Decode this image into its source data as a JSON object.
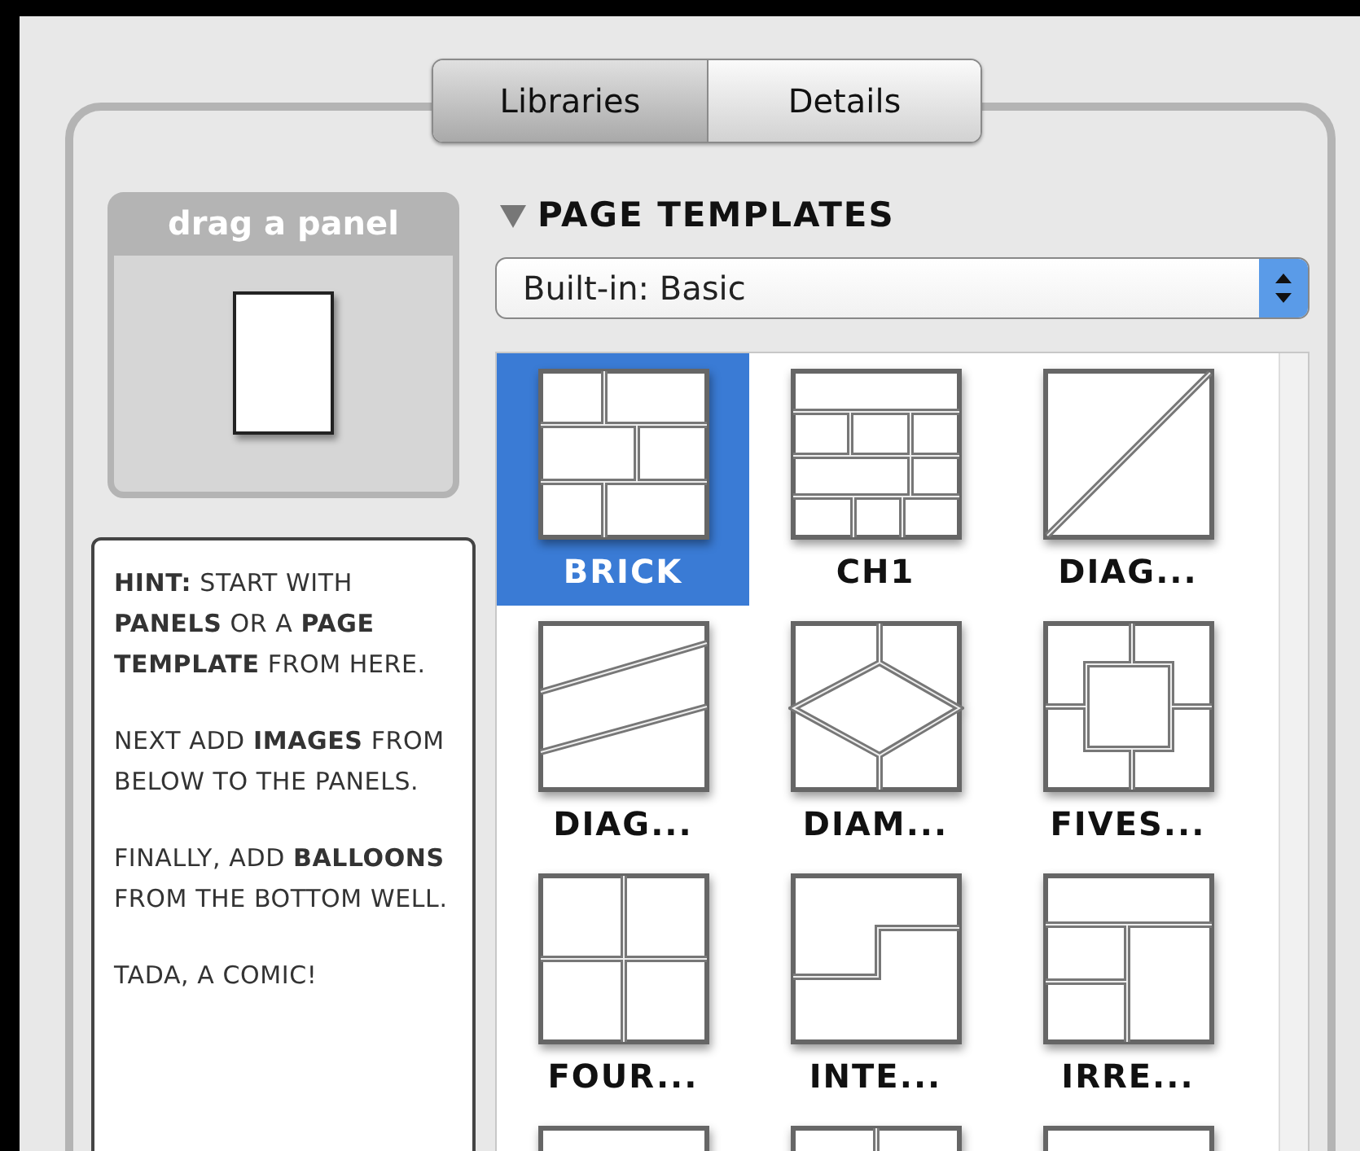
{
  "tabs": [
    {
      "label": "Libraries",
      "selected": true
    },
    {
      "label": "Details",
      "selected": false
    }
  ],
  "panel_well": {
    "title": "drag a panel"
  },
  "hint": [
    "**HINT:** START WITH **PANELS** OR A **PAGE TEMPLATE** FROM HERE.",
    "NEXT ADD **IMAGES** FROM BELOW TO THE PANELS.",
    "FINALLY, ADD **BALLOONS** FROM THE BOTTOM WELL.",
    "TADA, A COMIC!"
  ],
  "page_templates": {
    "title": "PAGE TEMPLATES",
    "expanded": true,
    "library": "Built-in: Basic",
    "templates": [
      {
        "label": "BRICK",
        "kind": "brick",
        "selected": true
      },
      {
        "label": "CH1",
        "kind": "ch1",
        "selected": false
      },
      {
        "label": "DIAG...",
        "kind": "diagonal",
        "selected": false
      },
      {
        "label": "DIAG...",
        "kind": "strips",
        "selected": false
      },
      {
        "label": "DIAM...",
        "kind": "diamond",
        "selected": false
      },
      {
        "label": "FIVES...",
        "kind": "fives",
        "selected": false
      },
      {
        "label": "FOUR...",
        "kind": "four",
        "selected": false
      },
      {
        "label": "INTE...",
        "kind": "interlock",
        "selected": false
      },
      {
        "label": "IRRE...",
        "kind": "irregular",
        "selected": false
      },
      {
        "kind": "cut",
        "selected": false
      },
      {
        "kind": "cut2",
        "selected": false
      },
      {
        "kind": "cut",
        "selected": false
      }
    ]
  }
}
